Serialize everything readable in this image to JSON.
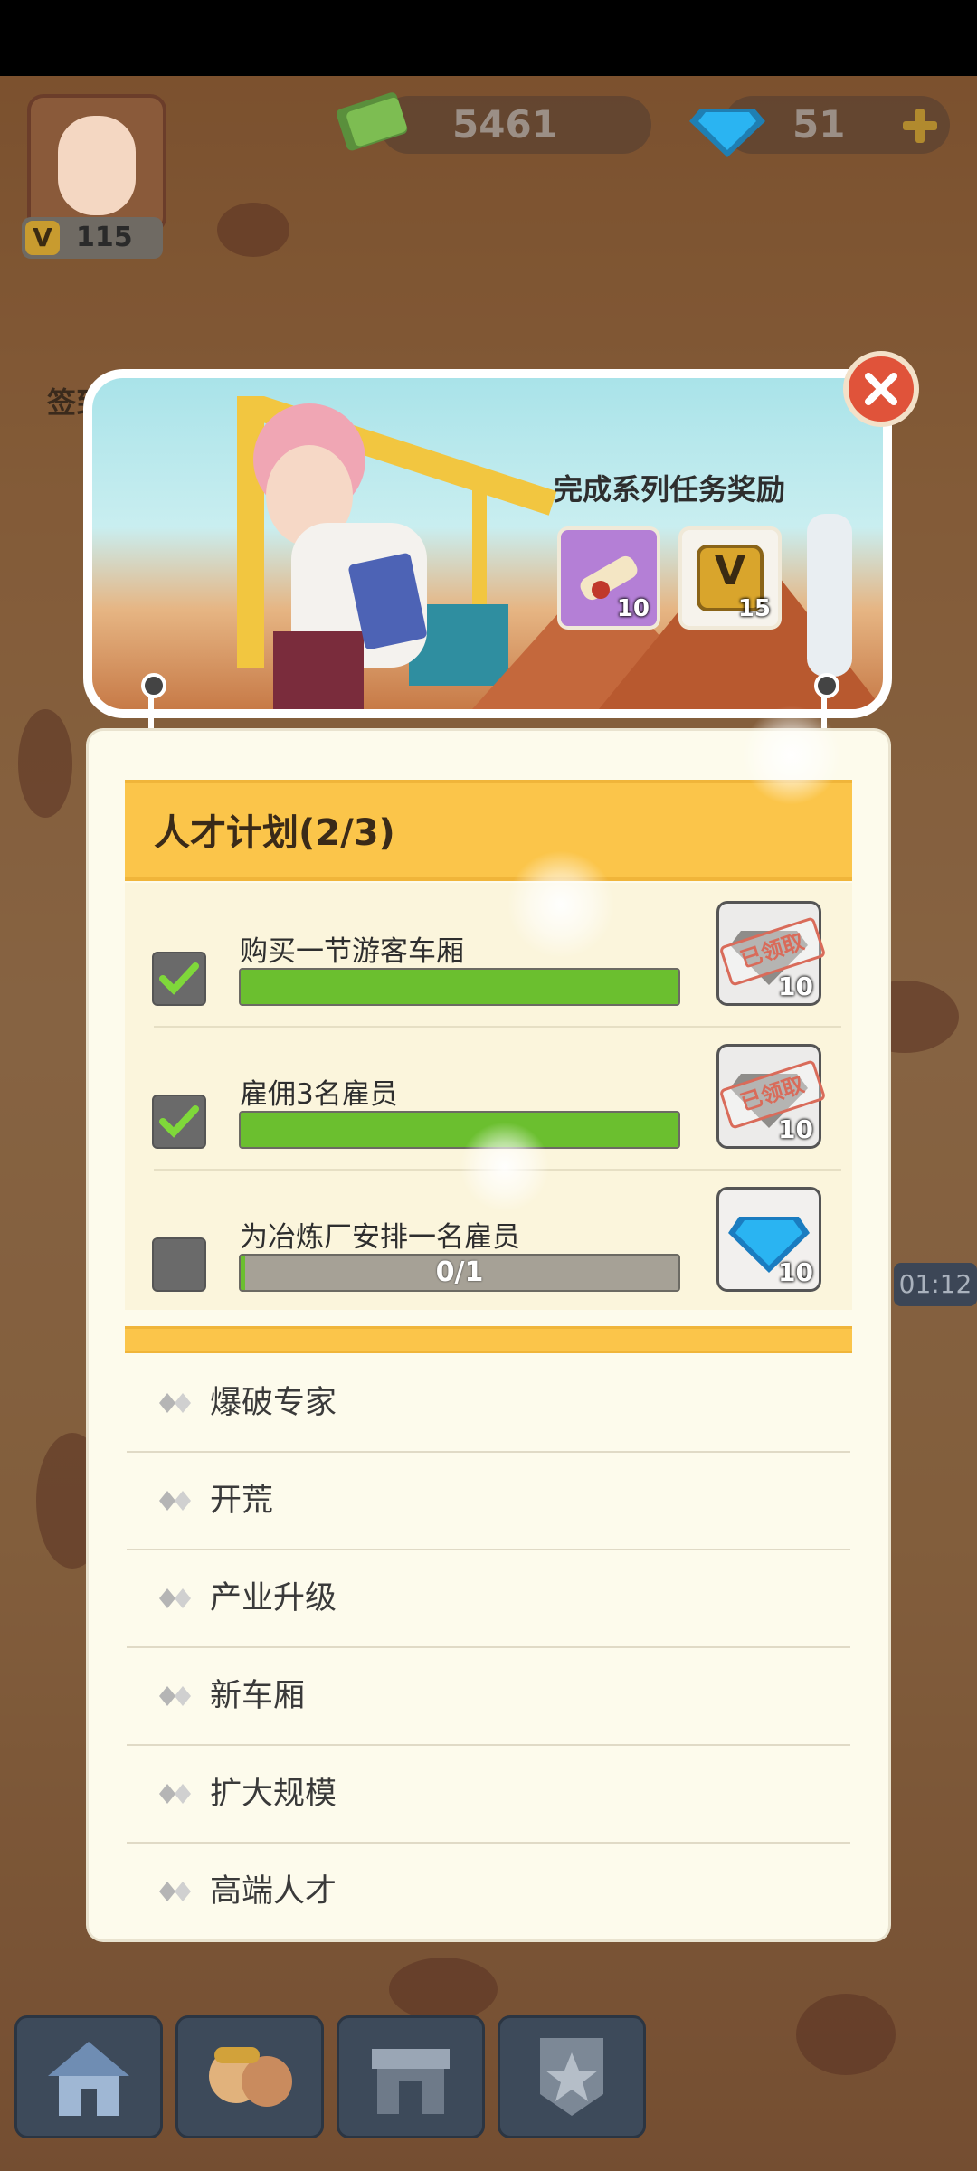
{
  "hud": {
    "player_level": "115",
    "level_prefix": "V",
    "cash": "5461",
    "gems": "51",
    "sign_in_label": "签到",
    "timer": "01:12"
  },
  "banner": {
    "reward_title": "完成系列任务奖励",
    "rewards": [
      {
        "icon": "scroll-icon",
        "count": "10"
      },
      {
        "icon": "v-point-icon",
        "label": "V",
        "count": "15"
      }
    ]
  },
  "mission": {
    "title": "人才计划(2/3)",
    "tasks": [
      {
        "label": "购买一节游客车厢",
        "completed": true,
        "progress": 1.0,
        "progress_text": "",
        "reward_icon": "gem-icon",
        "reward_count": "10",
        "claimed": true,
        "claimed_text": "已领取"
      },
      {
        "label": "雇佣3名雇员",
        "completed": true,
        "progress": 1.0,
        "progress_text": "",
        "reward_icon": "gem-icon",
        "reward_count": "10",
        "claimed": true,
        "claimed_text": "已领取"
      },
      {
        "label": "为冶炼厂安排一名雇员",
        "completed": false,
        "progress": 0.0,
        "progress_text": "0/1",
        "reward_icon": "gem-icon",
        "reward_count": "10",
        "claimed": false
      }
    ]
  },
  "series_list": [
    "爆破专家",
    "开荒",
    "产业升级",
    "新车厢",
    "扩大规模",
    "高端人才"
  ],
  "bottom_nav": [
    "home-icon",
    "workers-icon",
    "shop-icon",
    "achievement-star-icon"
  ],
  "colors": {
    "accent_yellow": "#fbc54a",
    "progress_green": "#6bbf2f",
    "close_red": "#e0533a",
    "gem_blue": "#2ab4f2"
  }
}
